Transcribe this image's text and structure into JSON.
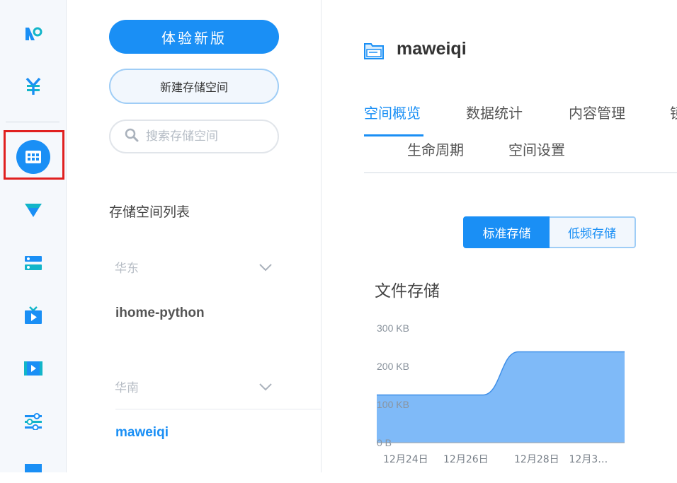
{
  "rail": {
    "items": [
      {
        "icon": "logo-icon"
      },
      {
        "icon": "yuan-icon"
      },
      {
        "icon": "grid-icon",
        "selected": true
      },
      {
        "icon": "funnel-icon"
      },
      {
        "icon": "server-icon"
      },
      {
        "icon": "tv-icon"
      },
      {
        "icon": "video-icon"
      },
      {
        "icon": "sliders-icon"
      },
      {
        "icon": "folder-icon"
      }
    ]
  },
  "panel": {
    "new_version_button": "体验新版",
    "create_bucket_button": "新建存储空间",
    "search": {
      "placeholder": "搜索存储空间",
      "value": ""
    },
    "list_heading": "存储空间列表",
    "regions": [
      {
        "name": "华东",
        "buckets": [
          "ihome-python"
        ]
      },
      {
        "name": "华南",
        "buckets": [
          "maweiqi"
        ]
      }
    ]
  },
  "main": {
    "title": "maweiqi",
    "tabs": [
      "空间概览",
      "数据统计",
      "内容管理",
      "镜",
      "生命周期",
      "空间设置"
    ],
    "active_tab": "空间概览",
    "storage_types": [
      "标准存储",
      "低频存储"
    ],
    "active_storage_type": "标准存储",
    "chart_title": "文件存储"
  },
  "colors": {
    "accent": "#1a8ff5",
    "chart_fill": "#7fbaf8",
    "chart_line": "#3f8fe8",
    "rail_bg": "#f5f8fc"
  },
  "chart_data": {
    "type": "area",
    "title": "文件存储",
    "xlabel": "",
    "ylabel": "",
    "ylim": [
      0,
      300
    ],
    "y_unit": "KB",
    "y_ticks": [
      "300 KB",
      "200 KB",
      "100 KB",
      "0 B"
    ],
    "x_ticks": [
      "12月24日",
      "12月26日",
      "12月28日",
      "12月3…"
    ],
    "x": [
      0,
      1,
      2,
      3,
      4,
      5,
      6,
      7
    ],
    "values": [
      125,
      125,
      125,
      125,
      238,
      238,
      238,
      238
    ],
    "grid": false,
    "legend": "none"
  }
}
